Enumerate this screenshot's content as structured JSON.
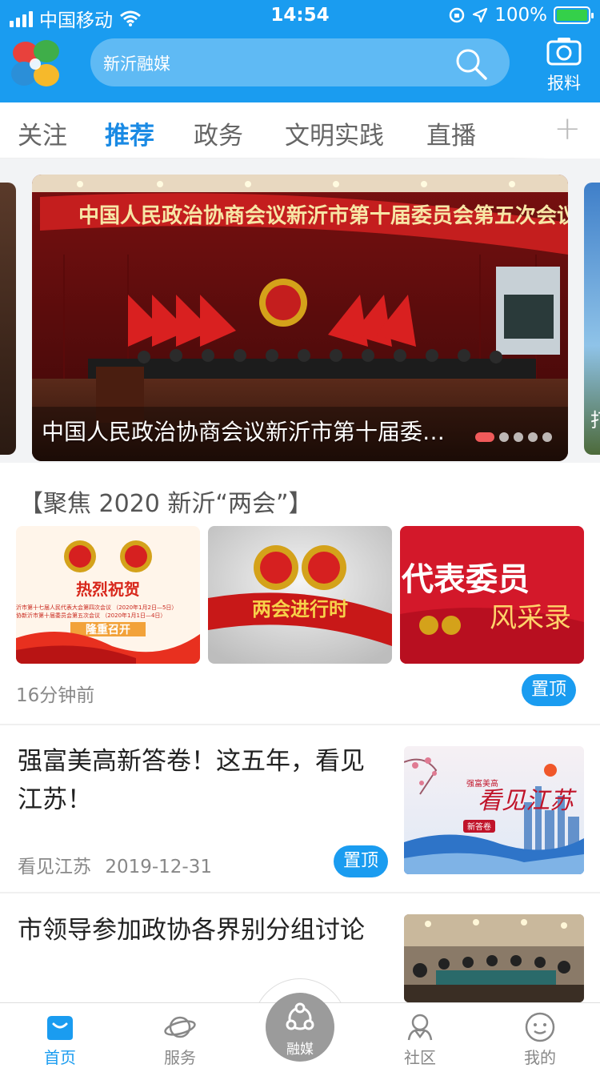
{
  "status_bar": {
    "carrier": "中国移动",
    "time": "14:54",
    "battery": "100%"
  },
  "header": {
    "search_placeholder": "新沂融媒",
    "report_label": "报料",
    "colors": {
      "primary": "#1a9cf0",
      "tab_active": "#1a8ae4",
      "badge": "#1a9cf0"
    }
  },
  "tabs": [
    {
      "label": "关注",
      "active": false
    },
    {
      "label": "推荐",
      "active": true
    },
    {
      "label": "政务",
      "active": false
    },
    {
      "label": "文明实践",
      "active": false
    },
    {
      "label": "直播",
      "active": false
    }
  ],
  "carousel": {
    "caption": "中国人民政治协商会议新沂市第十届委…",
    "banner_text": "中国人民政治协商会议新沂市第十届委员会第五次会议",
    "slide_count": 5,
    "active_index": 0,
    "next_caption_peek": "打"
  },
  "focus": {
    "title": "【聚焦 2020 新沂“两会”】",
    "thumbs": [
      {
        "name": "congrats",
        "headline": "热烈祝贺",
        "line1": "沂市第十七届人民代表大会第四次会议  （2020年1月2日—5日）",
        "line2": "协新沂市第十届委员会第五次会议  （2020年1月1日—4日）",
        "footer": "隆重召开"
      },
      {
        "name": "in-progress",
        "headline": "两会进行时"
      },
      {
        "name": "profiles",
        "headline": "代表委员",
        "line1": "风采录"
      }
    ],
    "time": "16分钟前",
    "pin_label": "置顶"
  },
  "news": [
    {
      "title_line1": "强富美高新答卷！这五年，看见",
      "title_line2": "江苏！",
      "source": "看见江苏",
      "date": "2019-12-31",
      "pin_label": "置顶",
      "image_text": {
        "big": "看见江苏",
        "small": "强富美高",
        "tag": "新答卷"
      }
    },
    {
      "title_line1": "市领导参加政协各界别分组讨论"
    }
  ],
  "bottom_nav": [
    {
      "label": "首页",
      "icon": "home-icon",
      "active": true
    },
    {
      "label": "服务",
      "icon": "planet-icon",
      "active": false
    },
    {
      "label": "融媒",
      "icon": "share-hub-icon",
      "active": false
    },
    {
      "label": "社区",
      "icon": "community-icon",
      "active": false
    },
    {
      "label": "我的",
      "icon": "smile-icon",
      "active": false
    }
  ]
}
